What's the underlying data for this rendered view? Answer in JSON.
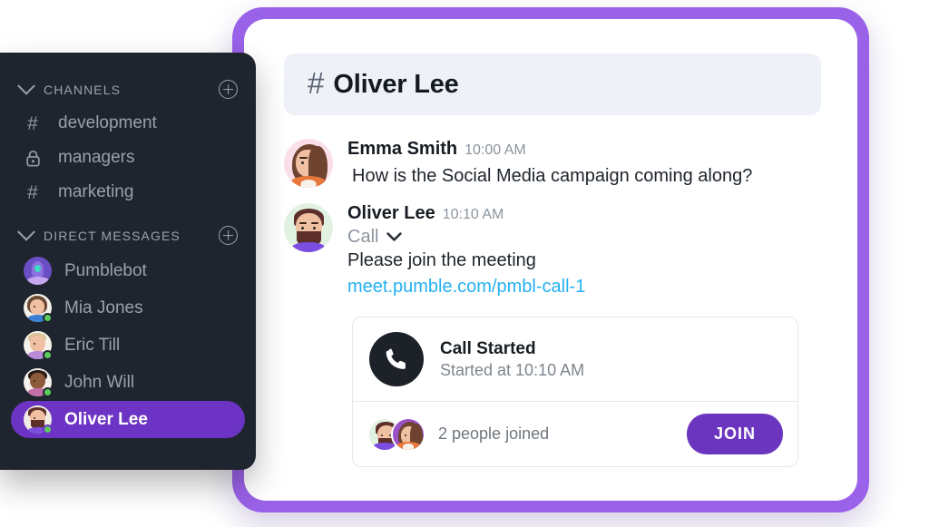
{
  "sidebar": {
    "channels_section": {
      "label": "CHANNELS",
      "collapse_icon": "chevron-down-icon",
      "add_icon": "add-channel-icon",
      "items": [
        {
          "name": "development",
          "icon": "hash-icon"
        },
        {
          "name": "managers",
          "icon": "lock-icon"
        },
        {
          "name": "marketing",
          "icon": "hash-icon"
        }
      ]
    },
    "dm_section": {
      "label": "DIRECT MESSAGES",
      "collapse_icon": "chevron-down-icon",
      "add_icon": "add-direct-message-icon",
      "items": [
        {
          "name": "Pumblebot",
          "online": false,
          "active": false
        },
        {
          "name": "Mia Jones",
          "online": true,
          "active": false
        },
        {
          "name": "Eric Till",
          "online": true,
          "active": false
        },
        {
          "name": "John Will",
          "online": true,
          "active": false
        },
        {
          "name": "Oliver Lee",
          "online": true,
          "active": true
        }
      ]
    }
  },
  "chat": {
    "header": {
      "hash": "#",
      "title": "Oliver Lee"
    },
    "messages": [
      {
        "author": "Emma Smith",
        "time": "10:00 AM",
        "text": "How is the Social Media campaign coming along?"
      },
      {
        "author": "Oliver Lee",
        "time": "10:10 AM",
        "call_label": "Call",
        "line": "Please join the meeting",
        "link": "meet.pumble.com/pmbl-call-1"
      }
    ],
    "call_card": {
      "icon": "phone-icon",
      "title": "Call Started",
      "subtitle": "Started at 10:10 AM",
      "joined_text": "2 people joined",
      "join_label": "JOIN"
    }
  },
  "colors": {
    "frame_purple": "#9a62e8",
    "accent_purple": "#6b35bf",
    "active_dm_purple": "#6c33c4",
    "link_blue": "#25b0f0",
    "sidebar_bg": "#1f252e",
    "header_bg": "#eef1f6",
    "online_green": "#5bcc5b",
    "call_icon_bg": "#1d2228"
  }
}
